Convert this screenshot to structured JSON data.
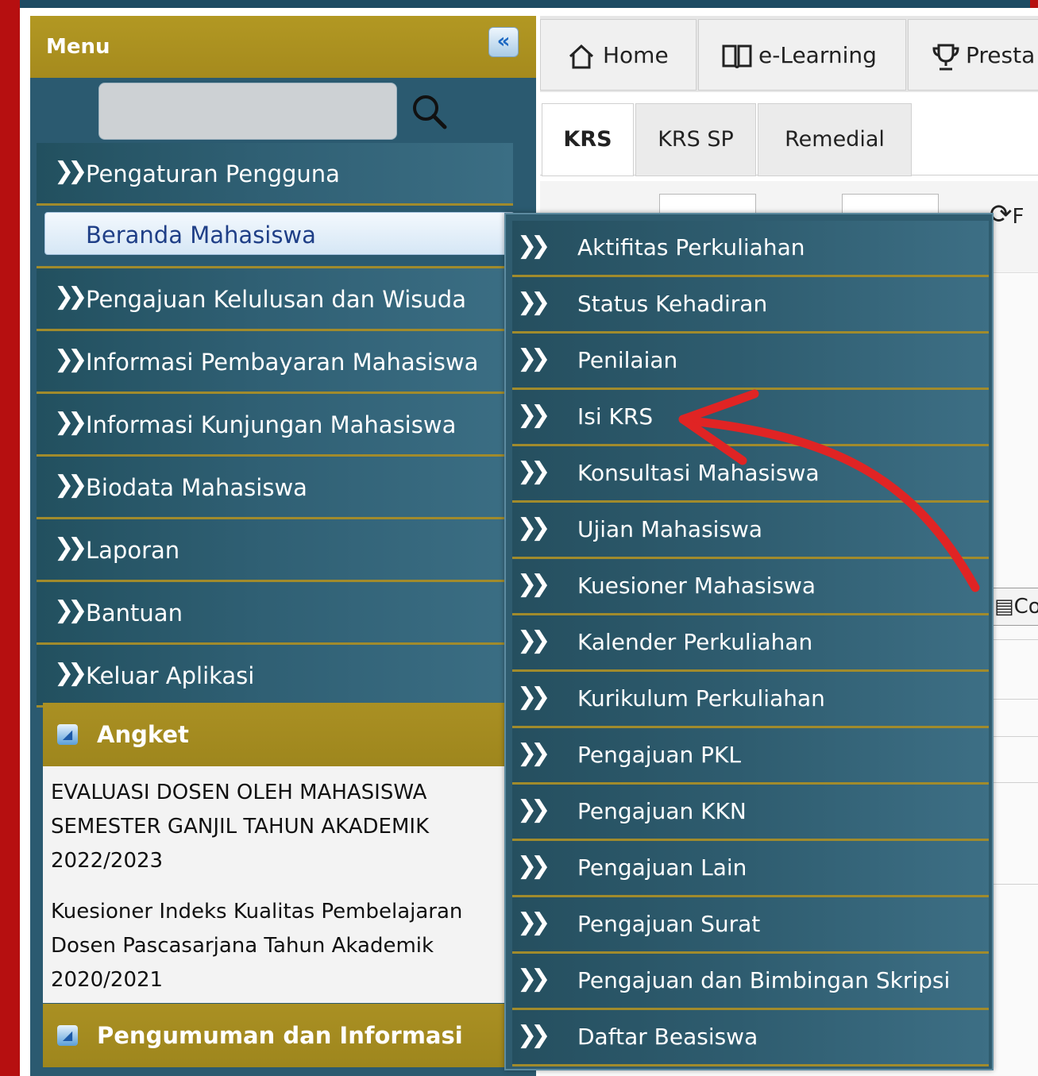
{
  "sidebar": {
    "title": "Menu",
    "collapse_icon": "«",
    "search": {
      "value": "",
      "placeholder": ""
    },
    "items": [
      {
        "label": "Pengaturan Pengguna"
      },
      {
        "label": "Beranda Mahasiswa"
      },
      {
        "label": "Pengajuan Kelulusan dan Wisuda"
      },
      {
        "label": "Informasi Pembayaran Mahasiswa"
      },
      {
        "label": "Informasi Kunjungan Mahasiswa"
      },
      {
        "label": "Biodata Mahasiswa"
      },
      {
        "label": "Laporan"
      },
      {
        "label": "Bantuan"
      },
      {
        "label": "Keluar Aplikasi"
      }
    ],
    "angket": {
      "title": "Angket",
      "entries": [
        "EVALUASI DOSEN OLEH MAHASISWA SEMESTER GANJIL TAHUN AKADEMIK 2022/2023",
        "Kuesioner Indeks Kualitas Pembelajaran Dosen Pascasarjana Tahun Akademik 2020/2021"
      ]
    },
    "pengumuman": {
      "title": "Pengumuman dan Informasi"
    }
  },
  "top_tabs": [
    {
      "label": "Home",
      "icon": "home-icon"
    },
    {
      "label": "e-Learning",
      "icon": "book-icon"
    },
    {
      "label": "Presta",
      "icon": "trophy-icon"
    }
  ],
  "sub_tabs": [
    {
      "label": "KRS",
      "active": true
    },
    {
      "label": "KRS SP",
      "active": false
    },
    {
      "label": "Remedial",
      "active": false
    }
  ],
  "toolbar": {
    "refresh_partial": "F",
    "button_partial": "Co"
  },
  "submenu": [
    "Aktifitas Perkuliahan",
    "Status Kehadiran",
    "Penilaian",
    "Isi KRS",
    "Konsultasi Mahasiswa",
    "Ujian Mahasiswa",
    "Kuesioner Mahasiswa",
    "Kalender Perkuliahan",
    "Kurikulum Perkuliahan",
    "Pengajuan PKL",
    "Pengajuan KKN",
    "Pengajuan Lain",
    "Pengajuan Surat",
    "Pengajuan dan Bimbingan Skripsi",
    "Daftar Beasiswa"
  ],
  "colors": {
    "border_red": "#b60f10",
    "menu_gold": "#a58a1d",
    "menu_teal": "#2b5a70",
    "annotation_arrow": "#e02424"
  }
}
